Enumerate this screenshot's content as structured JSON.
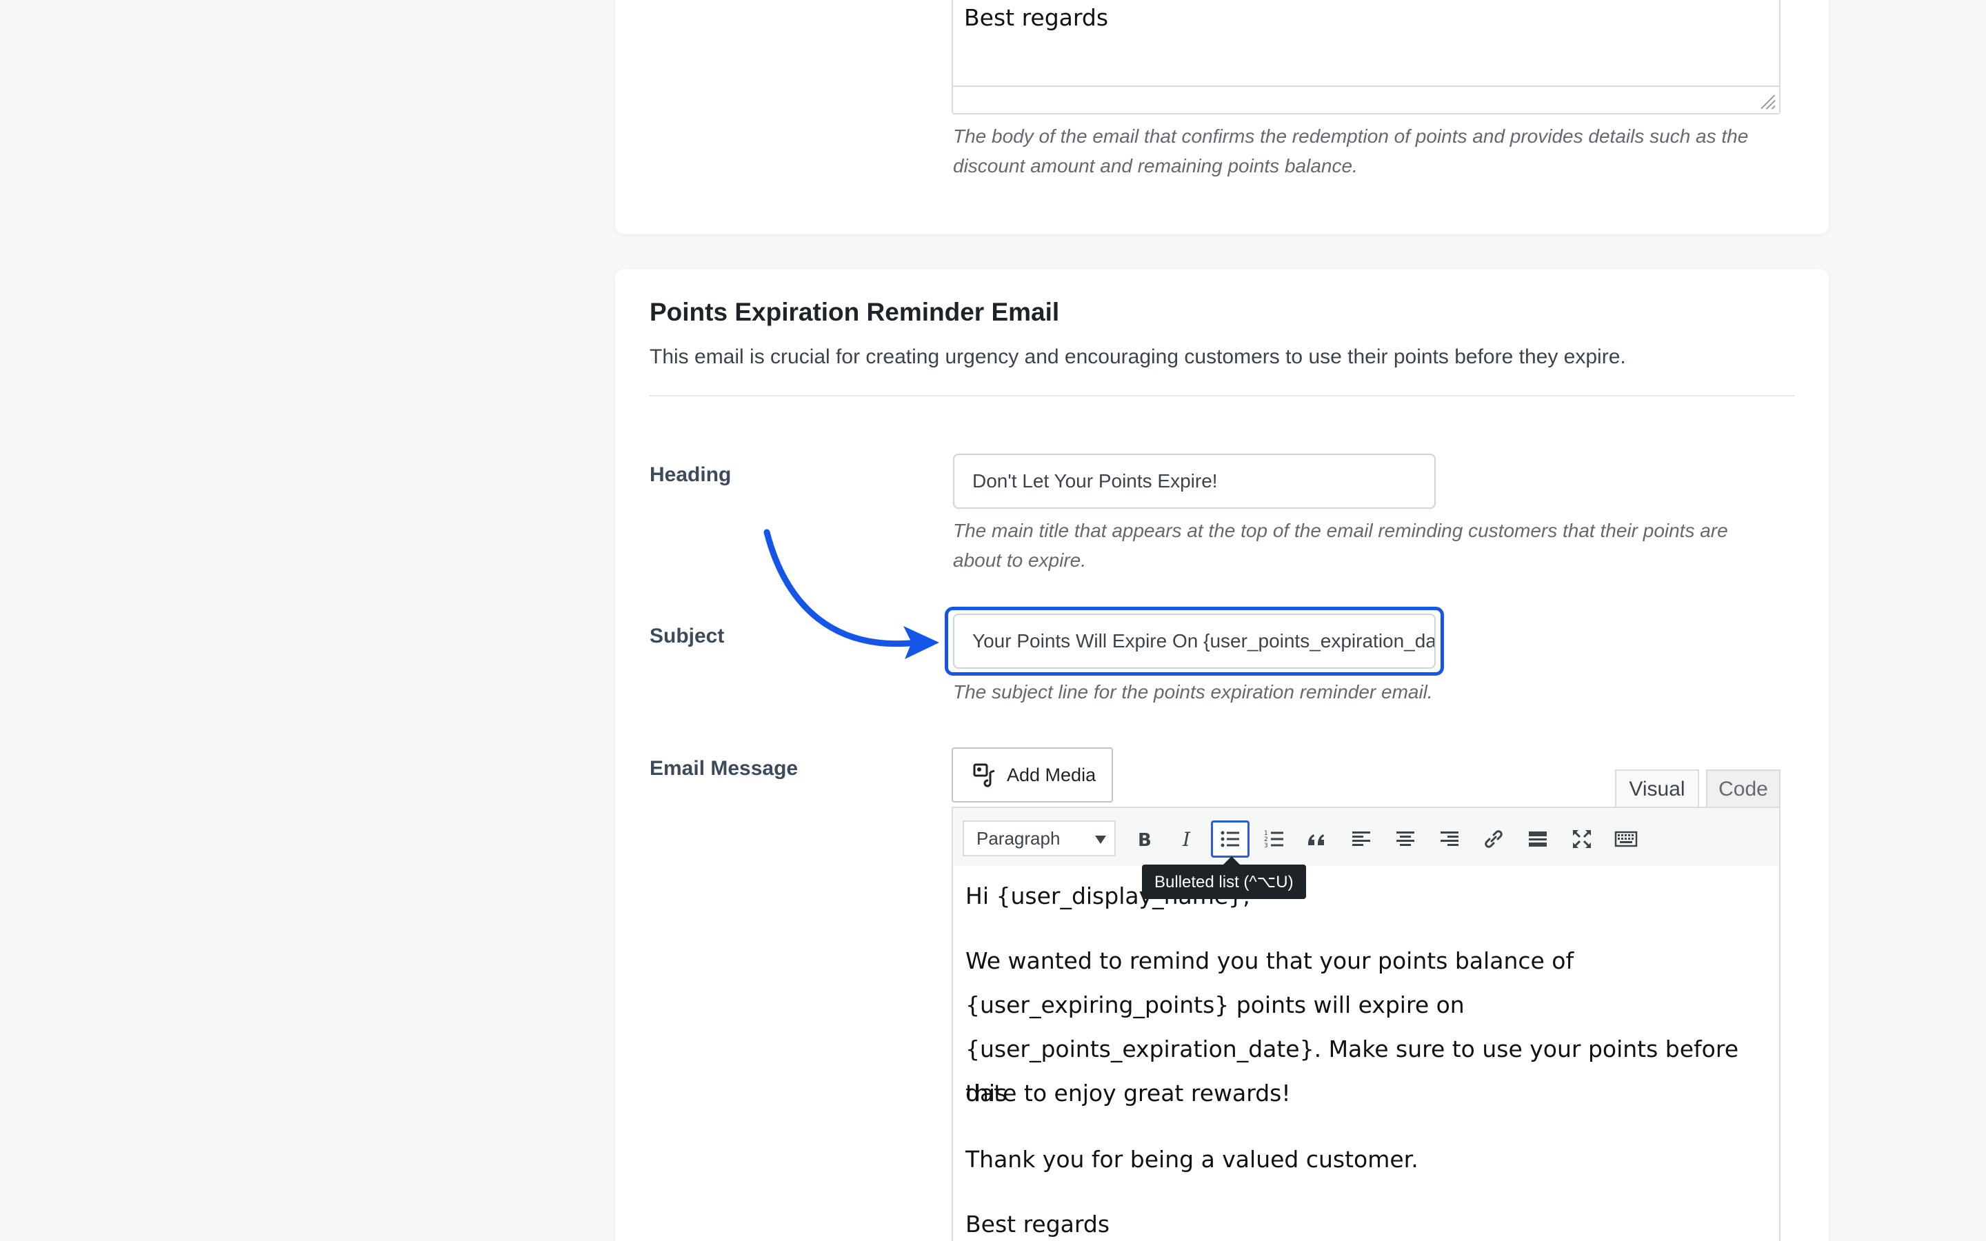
{
  "top_section": {
    "textarea_line": "Best regards",
    "description": "The body of the email that confirms the redemption of points and provides details such as the discount amount and remaining points balance."
  },
  "section": {
    "title": "Points Expiration Reminder Email",
    "subtitle": "This email is crucial for creating urgency and encouraging customers to use their points before they expire."
  },
  "heading_field": {
    "label": "Heading",
    "value": "Don't Let Your Points Expire!",
    "description": "The main title that appears at the top of the email reminding customers that their points are about to expire."
  },
  "subject_field": {
    "label": "Subject",
    "value": "Your Points Will Expire On {user_points_expiration_date}",
    "description": "The subject line for the points expiration reminder email."
  },
  "message_field": {
    "label": "Email Message",
    "add_media_label": "Add Media",
    "tabs": [
      "Visual",
      "Code"
    ],
    "format_select": "Paragraph",
    "tooltip": "Bulleted list (^⌥U)",
    "body": {
      "p1": "Hi {user_display_name},",
      "p2_l1": "We wanted to remind you that your points balance of",
      "p2_l2": "{user_expiring_points} points will expire on",
      "p2_l3": "{user_points_expiration_date}. Make sure to use your points before this",
      "p2_l4": "date to enjoy great rewards!",
      "p3": "Thank you for being a valued customer.",
      "p4": "Best regards"
    }
  },
  "colors": {
    "highlight": "#1556e8",
    "arrow": "#1556e8"
  }
}
